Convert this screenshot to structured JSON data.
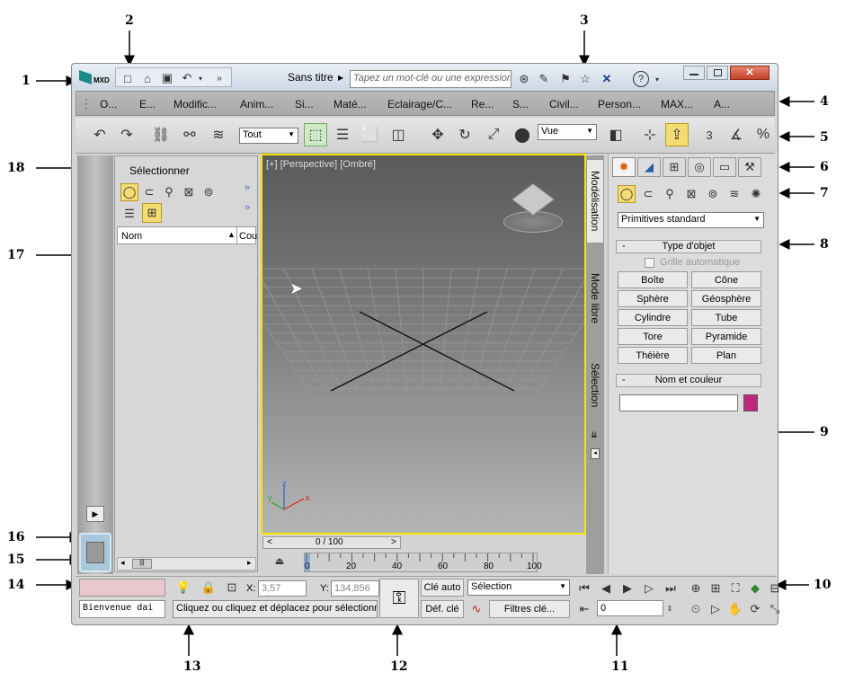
{
  "callouts": {
    "c1": "1",
    "c2": "2",
    "c3": "3",
    "c4": "4",
    "c5": "5",
    "c6": "6",
    "c7": "7",
    "c8": "8",
    "c9": "9",
    "c10": "10",
    "c11": "11",
    "c12": "12",
    "c13": "13",
    "c14": "14",
    "c15": "15",
    "c16": "16",
    "c17": "17",
    "c18": "18"
  },
  "titlebar": {
    "app_badge": "MXD",
    "title": "Sans titre",
    "search_placeholder": "Tapez un mot-clé ou une expression"
  },
  "menu": [
    "O...",
    "E...",
    "Modific...",
    "Anim...",
    "Si...",
    "Maté...",
    "Eclairage/C...",
    "Re...",
    "S...",
    "Civil...",
    "Person...",
    "MAX...",
    "A..."
  ],
  "toolbar": {
    "filter_value": "Tout",
    "refcoord_value": "Vue",
    "snap_3": "3",
    "percent": "%"
  },
  "scene_explorer": {
    "title": "Sélectionner",
    "col_name": "Nom",
    "col_cou": "Cou"
  },
  "viewport": {
    "label": "[+] [Perspective] [Ombré]",
    "axis_x": "x",
    "axis_y": "y",
    "axis_z": "z"
  },
  "ribbon_tabs": {
    "modelisation": "Modélisation",
    "mode_libre": "Mode libre",
    "selection": "Sélection"
  },
  "command_panel": {
    "dropdown": "Primitives standard",
    "rollout_type": "Type d'objet",
    "autogrid": "Grille automatique",
    "buttons": [
      "Boîte",
      "Cône",
      "Sphère",
      "Géosphère",
      "Cylindre",
      "Tube",
      "Tore",
      "Pyramide",
      "Théière",
      "Plan"
    ],
    "rollout_name": "Nom et couleur",
    "object_color": "#c02880",
    "minus": "-"
  },
  "timeline": {
    "slider": "0 / 100",
    "prev": "<",
    "next": ">",
    "ticks": [
      "0",
      "20",
      "40",
      "60",
      "80",
      "100"
    ]
  },
  "status": {
    "welcome": "Bienvenue dai",
    "prompt": "Cliquez ou cliquez et déplacez pour sélectionne",
    "x_label": "X:",
    "x_value": "3,57",
    "y_label": "Y:",
    "y_value": "134,856",
    "cle_auto": "Clé auto",
    "def_cle": "Déf. clé",
    "selection": "Sélection",
    "filtres": "Filtres clé...",
    "frame": "0"
  },
  "colors": {
    "viewport_border": "#f2e500",
    "active_tool": "#f4dc72",
    "maxscript_bg": "#e8c8cc"
  }
}
